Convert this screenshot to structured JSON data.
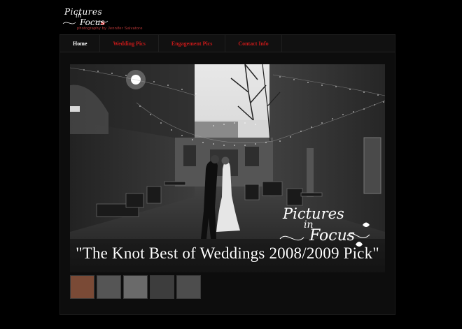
{
  "logo": {
    "line1": "Pictures",
    "line2": "in",
    "line3": "Focus",
    "tagline": "photography by Jennifer Salvatore"
  },
  "nav": {
    "items": [
      {
        "label": "Home",
        "active": true
      },
      {
        "label": "Wedding Pics",
        "active": false
      },
      {
        "label": "Engagement Pics",
        "active": false
      },
      {
        "label": "Contact Info",
        "active": false
      }
    ]
  },
  "slideshow": {
    "caption": "\"The Knot Best of Weddings 2008/2009 Pick\"",
    "watermark": {
      "line1": "Pictures",
      "line2": "in",
      "line3": "Focus"
    },
    "thumbnails": [
      {
        "name": "thumbnail-1",
        "color": "#7a4a36"
      },
      {
        "name": "thumbnail-2",
        "color": "#555555"
      },
      {
        "name": "thumbnail-3",
        "color": "#6a6a6a"
      },
      {
        "name": "thumbnail-4",
        "color": "#3d3d3d"
      },
      {
        "name": "thumbnail-5",
        "color": "#4d4d4d"
      }
    ]
  },
  "colors": {
    "accent": "#c41919",
    "background": "#000000",
    "frame": "#0d0d0d"
  }
}
